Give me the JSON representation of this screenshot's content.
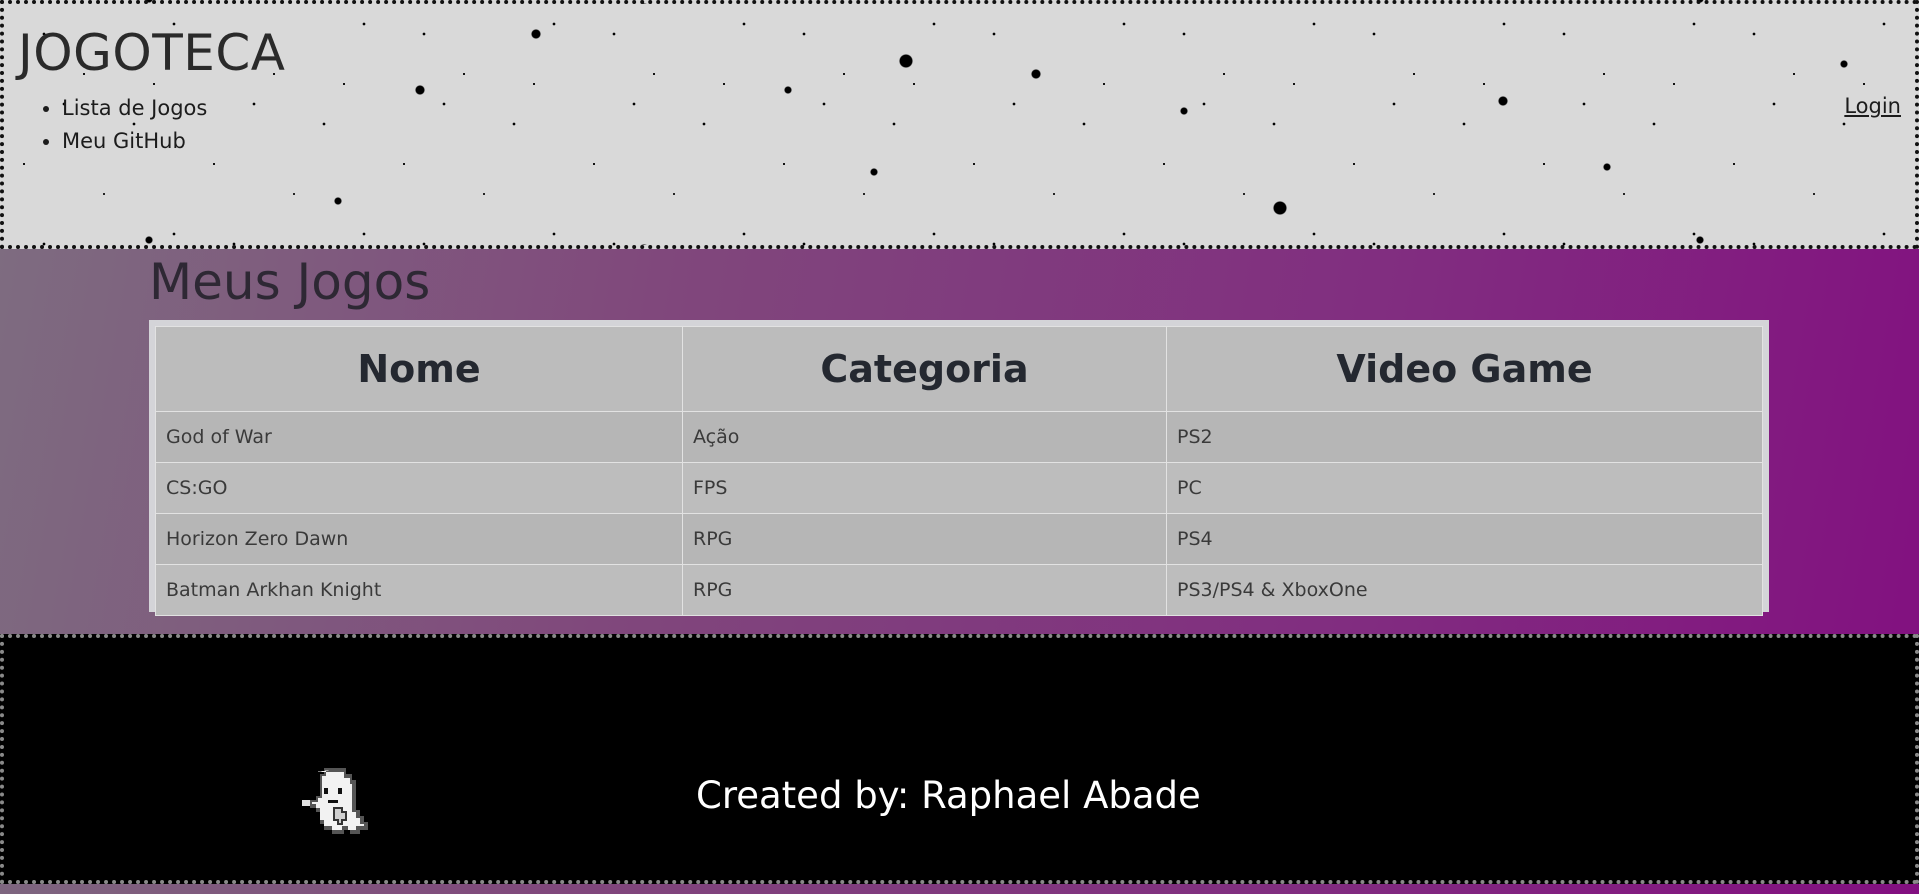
{
  "header": {
    "site_title": "JOGOTECA",
    "nav_items": [
      {
        "label": "Lista de Jogos"
      },
      {
        "label": "Meu GitHub"
      }
    ],
    "login_label": "Login"
  },
  "main": {
    "heading": "Meus Jogos",
    "table": {
      "columns": [
        "Nome",
        "Categoria",
        "Video Game"
      ],
      "rows": [
        [
          "God of War",
          "Ação",
          "PS2"
        ],
        [
          "CS:GO",
          "FPS",
          "PC"
        ],
        [
          "Horizon Zero Dawn",
          "RPG",
          "PS4"
        ],
        [
          "Batman Arkhan Knight",
          "RPG",
          "PS3/PS4 & XboxOne"
        ]
      ]
    }
  },
  "footer": {
    "credit": "Created by: Raphael Abade",
    "mascot_icon": "ghost-icon"
  },
  "colors": {
    "header_bg": "#d9d9d9",
    "body_gradient_start": "#7e6e80",
    "body_gradient_end": "#820f80",
    "table_bg": "#bcbcbc",
    "footer_bg": "#000000"
  }
}
